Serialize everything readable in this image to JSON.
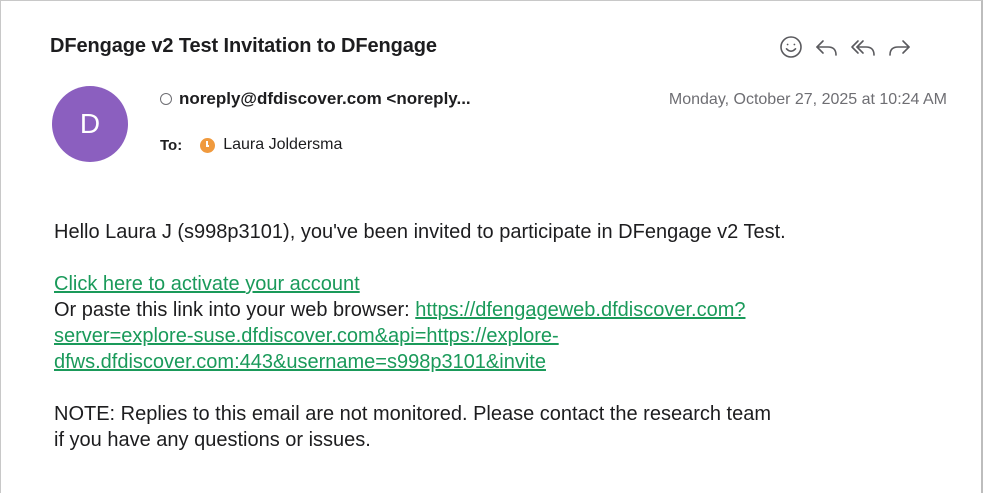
{
  "email": {
    "subject": "DFengage v2 Test Invitation to DFengage",
    "avatar_initial": "D",
    "from": "noreply@dfdiscover.com <noreply...",
    "date": "Monday, October 27, 2025 at 10:24 AM",
    "to_label": "To:",
    "to_name": "Laura Joldersma",
    "greeting": "Hello Laura J (s998p3101), you've been invited to participate in DFengage v2 Test.",
    "activate_link": "Click here to activate your account",
    "paste_prefix": "Or paste this link into your web browser: ",
    "url_line1": "https://dfengageweb.dfdiscover.com?",
    "url_line2": "server=explore-suse.dfdiscover.com&api=https://explore-",
    "url_line3": "dfws.dfdiscover.com:443&username=s998p3101&invite",
    "note_line1": "NOTE: Replies to this email are not monitored. Please contact the research team",
    "note_line2": "if you have any questions or issues."
  },
  "toolbar": {
    "icons": [
      "emoji-icon",
      "reply-icon",
      "reply-all-icon",
      "forward-icon"
    ]
  },
  "colors": {
    "avatar": "#8b5fbf",
    "link": "#1a9a5a",
    "contact_badge": "#f09a3e"
  }
}
